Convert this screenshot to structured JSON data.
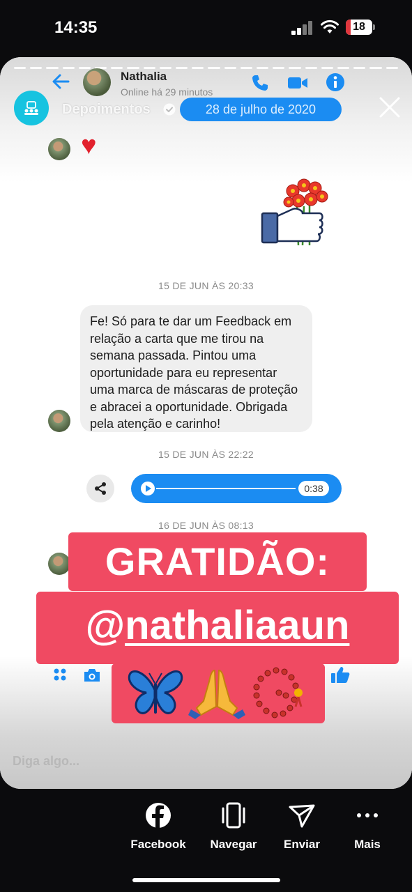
{
  "status_bar": {
    "time": "14:35",
    "battery": "18",
    "battery_level": 0.18
  },
  "messenger_header": {
    "contact_name": "Nathalia",
    "contact_status": "Online há 29 minutos"
  },
  "story": {
    "account_name": "Depoimentos",
    "date_label": "28 de julho de 2020"
  },
  "conversation": {
    "timestamp_1": "15 DE JUN ÀS 20:33",
    "message_text": "Fe! Só para te dar um Feedback em relação a carta que me tirou na semana passada. Pintou uma oportunidade para eu representar uma marca de máscaras de proteção e abracei a oportunidade. Obrigada pela atenção e carinho!",
    "timestamp_2": "15 DE JUN ÀS 22:22",
    "audio_duration": "0:38",
    "timestamp_3": "16 DE JUN ÀS 08:13"
  },
  "sticker": {
    "title": "GRATIDÃO:",
    "handle_prefix": "@",
    "handle": "nathaliaaun"
  },
  "composer": {
    "placeholder": "Diga algo..."
  },
  "actions": [
    {
      "label": "Facebook",
      "icon": "facebook-icon"
    },
    {
      "label": "Navegar",
      "icon": "phone-browse-icon"
    },
    {
      "label": "Enviar",
      "icon": "send-icon"
    },
    {
      "label": "Mais",
      "icon": "more-icon"
    }
  ],
  "colors": {
    "messenger_blue": "#1b8cf2",
    "sticker_pink": "#f04a62",
    "account_cyan": "#16c3e0",
    "battery_red": "#e0363d"
  }
}
